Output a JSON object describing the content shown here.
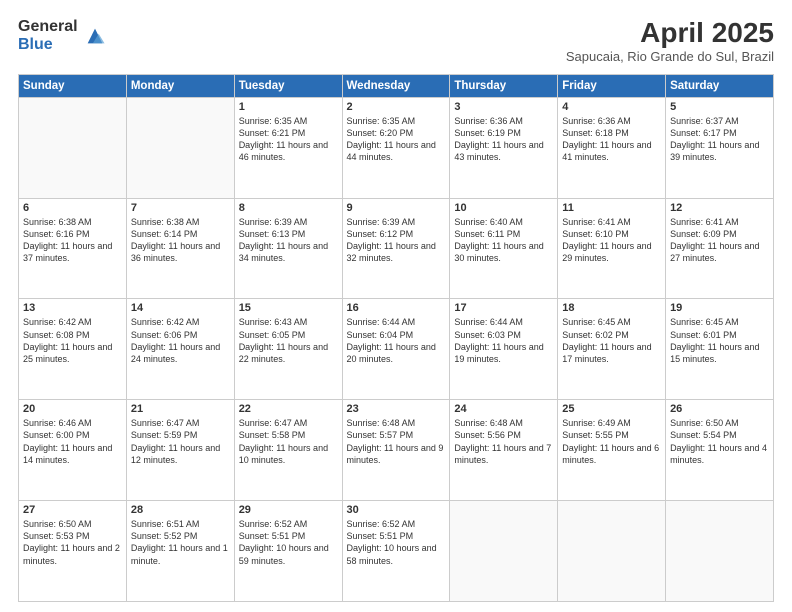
{
  "header": {
    "logo_general": "General",
    "logo_blue": "Blue",
    "title": "April 2025",
    "location": "Sapucaia, Rio Grande do Sul, Brazil"
  },
  "days_of_week": [
    "Sunday",
    "Monday",
    "Tuesday",
    "Wednesday",
    "Thursday",
    "Friday",
    "Saturday"
  ],
  "weeks": [
    [
      {
        "day": "",
        "info": ""
      },
      {
        "day": "",
        "info": ""
      },
      {
        "day": "1",
        "info": "Sunrise: 6:35 AM\nSunset: 6:21 PM\nDaylight: 11 hours and 46 minutes."
      },
      {
        "day": "2",
        "info": "Sunrise: 6:35 AM\nSunset: 6:20 PM\nDaylight: 11 hours and 44 minutes."
      },
      {
        "day": "3",
        "info": "Sunrise: 6:36 AM\nSunset: 6:19 PM\nDaylight: 11 hours and 43 minutes."
      },
      {
        "day": "4",
        "info": "Sunrise: 6:36 AM\nSunset: 6:18 PM\nDaylight: 11 hours and 41 minutes."
      },
      {
        "day": "5",
        "info": "Sunrise: 6:37 AM\nSunset: 6:17 PM\nDaylight: 11 hours and 39 minutes."
      }
    ],
    [
      {
        "day": "6",
        "info": "Sunrise: 6:38 AM\nSunset: 6:16 PM\nDaylight: 11 hours and 37 minutes."
      },
      {
        "day": "7",
        "info": "Sunrise: 6:38 AM\nSunset: 6:14 PM\nDaylight: 11 hours and 36 minutes."
      },
      {
        "day": "8",
        "info": "Sunrise: 6:39 AM\nSunset: 6:13 PM\nDaylight: 11 hours and 34 minutes."
      },
      {
        "day": "9",
        "info": "Sunrise: 6:39 AM\nSunset: 6:12 PM\nDaylight: 11 hours and 32 minutes."
      },
      {
        "day": "10",
        "info": "Sunrise: 6:40 AM\nSunset: 6:11 PM\nDaylight: 11 hours and 30 minutes."
      },
      {
        "day": "11",
        "info": "Sunrise: 6:41 AM\nSunset: 6:10 PM\nDaylight: 11 hours and 29 minutes."
      },
      {
        "day": "12",
        "info": "Sunrise: 6:41 AM\nSunset: 6:09 PM\nDaylight: 11 hours and 27 minutes."
      }
    ],
    [
      {
        "day": "13",
        "info": "Sunrise: 6:42 AM\nSunset: 6:08 PM\nDaylight: 11 hours and 25 minutes."
      },
      {
        "day": "14",
        "info": "Sunrise: 6:42 AM\nSunset: 6:06 PM\nDaylight: 11 hours and 24 minutes."
      },
      {
        "day": "15",
        "info": "Sunrise: 6:43 AM\nSunset: 6:05 PM\nDaylight: 11 hours and 22 minutes."
      },
      {
        "day": "16",
        "info": "Sunrise: 6:44 AM\nSunset: 6:04 PM\nDaylight: 11 hours and 20 minutes."
      },
      {
        "day": "17",
        "info": "Sunrise: 6:44 AM\nSunset: 6:03 PM\nDaylight: 11 hours and 19 minutes."
      },
      {
        "day": "18",
        "info": "Sunrise: 6:45 AM\nSunset: 6:02 PM\nDaylight: 11 hours and 17 minutes."
      },
      {
        "day": "19",
        "info": "Sunrise: 6:45 AM\nSunset: 6:01 PM\nDaylight: 11 hours and 15 minutes."
      }
    ],
    [
      {
        "day": "20",
        "info": "Sunrise: 6:46 AM\nSunset: 6:00 PM\nDaylight: 11 hours and 14 minutes."
      },
      {
        "day": "21",
        "info": "Sunrise: 6:47 AM\nSunset: 5:59 PM\nDaylight: 11 hours and 12 minutes."
      },
      {
        "day": "22",
        "info": "Sunrise: 6:47 AM\nSunset: 5:58 PM\nDaylight: 11 hours and 10 minutes."
      },
      {
        "day": "23",
        "info": "Sunrise: 6:48 AM\nSunset: 5:57 PM\nDaylight: 11 hours and 9 minutes."
      },
      {
        "day": "24",
        "info": "Sunrise: 6:48 AM\nSunset: 5:56 PM\nDaylight: 11 hours and 7 minutes."
      },
      {
        "day": "25",
        "info": "Sunrise: 6:49 AM\nSunset: 5:55 PM\nDaylight: 11 hours and 6 minutes."
      },
      {
        "day": "26",
        "info": "Sunrise: 6:50 AM\nSunset: 5:54 PM\nDaylight: 11 hours and 4 minutes."
      }
    ],
    [
      {
        "day": "27",
        "info": "Sunrise: 6:50 AM\nSunset: 5:53 PM\nDaylight: 11 hours and 2 minutes."
      },
      {
        "day": "28",
        "info": "Sunrise: 6:51 AM\nSunset: 5:52 PM\nDaylight: 11 hours and 1 minute."
      },
      {
        "day": "29",
        "info": "Sunrise: 6:52 AM\nSunset: 5:51 PM\nDaylight: 10 hours and 59 minutes."
      },
      {
        "day": "30",
        "info": "Sunrise: 6:52 AM\nSunset: 5:51 PM\nDaylight: 10 hours and 58 minutes."
      },
      {
        "day": "",
        "info": ""
      },
      {
        "day": "",
        "info": ""
      },
      {
        "day": "",
        "info": ""
      }
    ]
  ]
}
